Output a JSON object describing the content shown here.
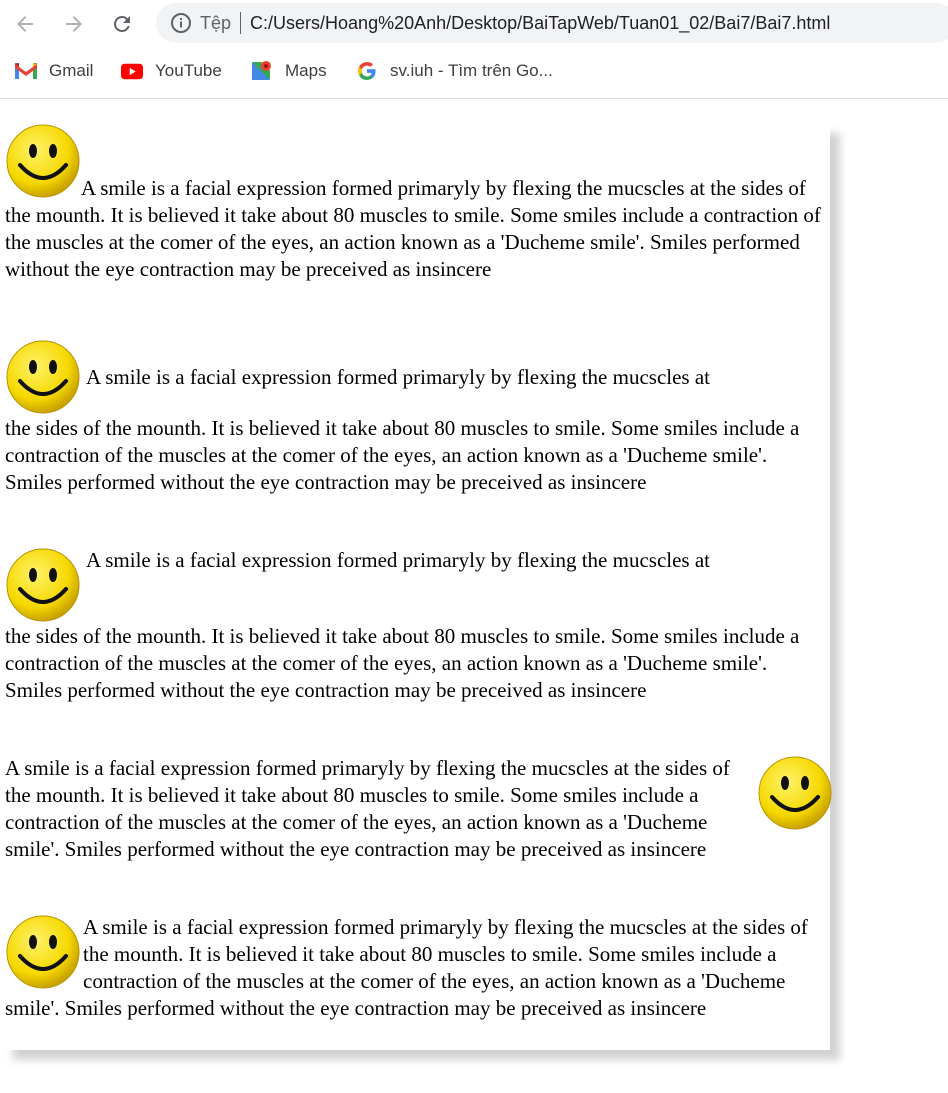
{
  "browser": {
    "scheme_label": "Tệp",
    "url": "C:/Users/Hoang%20Anh/Desktop/BaiTapWeb/Tuan01_02/Bai7/Bai7.html",
    "bookmarks": [
      {
        "label": "Gmail",
        "icon": "gmail-icon"
      },
      {
        "label": "YouTube",
        "icon": "youtube-icon"
      },
      {
        "label": "Maps",
        "icon": "maps-icon"
      },
      {
        "label": "sv.iuh - Tìm trên Go...",
        "icon": "google-icon"
      }
    ]
  },
  "content": {
    "first_line": "A smile is a facial expression formed primaryly by flexing the mucscles at",
    "rest": "the sides of the mounth. It is believed it take about 80 muscles to smile. Some smiles include a contraction of the muscles at the comer of the eyes, an action known as a 'Ducheme smile'. Smiles performed without the eye contraction may be preceived as insincere",
    "full": "A smile is a facial expression formed primaryly by flexing the mucscles at the sides of the mounth. It is believed it take about 80 muscles to smile. Some smiles include a contraction of the muscles at the comer of the eyes, an action known as a 'Ducheme smile'. Smiles performed without the eye contraction may be preceived as insincere"
  },
  "colors": {
    "smiley_face": "#f5d800",
    "omnibox_bg": "#f1f3f4"
  }
}
